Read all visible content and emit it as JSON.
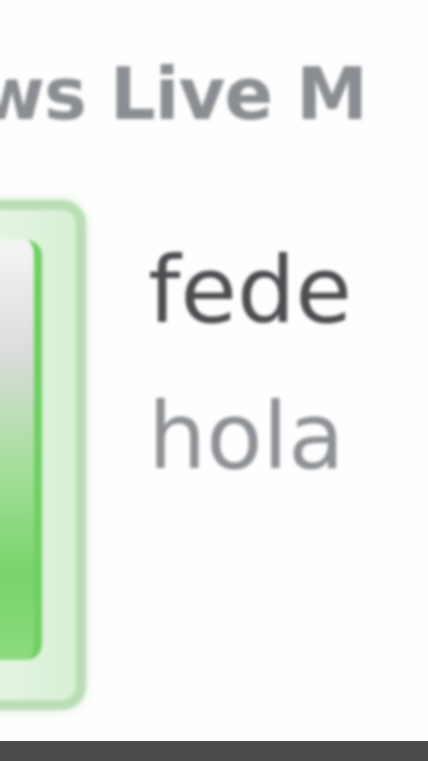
{
  "window": {
    "title": "ows Live M"
  },
  "notification": {
    "contact_name": "fede",
    "message": "hola",
    "avatar_icon": "user-avatar-icon",
    "accent_green": "#6fcf62"
  }
}
